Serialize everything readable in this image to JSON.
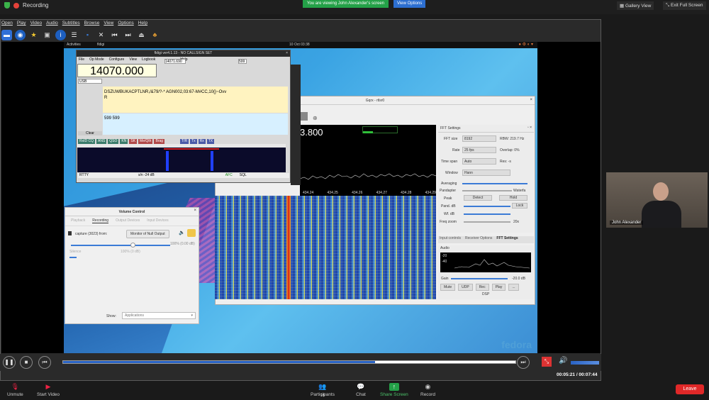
{
  "zoom": {
    "recording": "Recording",
    "banner": "You are viewing John Alexander's screen",
    "view_options": "View Options",
    "gallery_view": "Gallery View",
    "exit_full_screen": "Exit Full Screen",
    "participant_name": "John Alexander",
    "bottom": {
      "unmute": "Unmute",
      "start_video": "Start Video",
      "participants": "Participants",
      "participants_count": "16",
      "chat": "Chat",
      "share_screen": "Share Screen",
      "record": "Record",
      "leave": "Leave"
    }
  },
  "vlc": {
    "menu": [
      "Open",
      "Play",
      "Video",
      "Audio",
      "Subtitles",
      "Browse",
      "View",
      "Options",
      "Help"
    ],
    "time": "00:05:21 / 00:07:44",
    "progress": 0.69
  },
  "desktop": {
    "activities": "Activities",
    "app": "fldigi",
    "clock": "10 Oct  03:38",
    "watermark": "fedora"
  },
  "fldigi": {
    "title": "fldigi ver4.1.13 - NO CALLSIGN SET",
    "menu": [
      "File",
      "Op Mode",
      "Configure",
      "View",
      "Logbook",
      "Help"
    ],
    "frequency": "14070.000",
    "freq_field": "14071.690",
    "rst": "599",
    "mode": "USB",
    "rx_text": "DSZUWBUKACPTLNR,/&79/?-* AGN002,03:67-M#CC,10{}~Ovv\nR",
    "tx_text": "599 599",
    "status_mode": "RTTY",
    "status_sn": "s/n -24 dB",
    "status_afc": "AFC",
    "status_sql": "SQL",
    "clear": "Clear",
    "macros": [
      "RxID CQ",
      "ANS",
      "QSO",
      "KN",
      "SK",
      "Me/Qth",
      "Brag",
      "T/R",
      "Tx",
      "Rx",
      "TX"
    ]
  },
  "gqrx": {
    "title": "Gqrx - rtlsr0",
    "frequency_tail": "3.800",
    "freq_ticks": [
      "434.24",
      "434.25",
      "434.26",
      "434.27",
      "434.28",
      "434.29"
    ],
    "fft_settings_title": "FFT Settings",
    "fft": [
      {
        "label": "FFT size",
        "value": "8192",
        "extra": "RBW: 219.7 Hz"
      },
      {
        "label": "Rate",
        "value": "25 fps",
        "extra": "Overlap: 0%"
      },
      {
        "label": "Time span",
        "value": "Auto",
        "extra": "Res: -s"
      },
      {
        "label": "Window",
        "value": "Hann",
        "extra": ""
      }
    ],
    "fft_rows": [
      "Averaging",
      "Pandapter",
      "Peak",
      "Pand. dB",
      "Wf. dB",
      "Freq zoom"
    ],
    "peak_detect": "Detect",
    "peak_hold": "Hold",
    "lock": "Lock",
    "waterfall_label": "Waterfa",
    "zoom_value": "20x",
    "tabs": [
      "Input controls",
      "Receiver Options",
      "FFT Settings"
    ],
    "audio_title": "Audio",
    "audio_gain_label": "Gain",
    "audio_gain_value": "-20.0 dB",
    "audio_levels": [
      "-20",
      "-40"
    ],
    "audio_buttons": [
      "Mute",
      "UDP",
      "Rec",
      "Play",
      "..."
    ],
    "dsp": "DSP"
  },
  "volume": {
    "title": "Volume Control",
    "tabs": [
      "Playback",
      "Recording",
      "Output Devices",
      "Input Devices"
    ],
    "stream": "capture (3023) from:",
    "monitor_btn": "Monitor of Null Output",
    "percent": "100% (0.00 dB)",
    "silence": "Silence",
    "pct_label": "100% (0 dB)",
    "show_label": "Show:",
    "show_value": "Applications"
  }
}
